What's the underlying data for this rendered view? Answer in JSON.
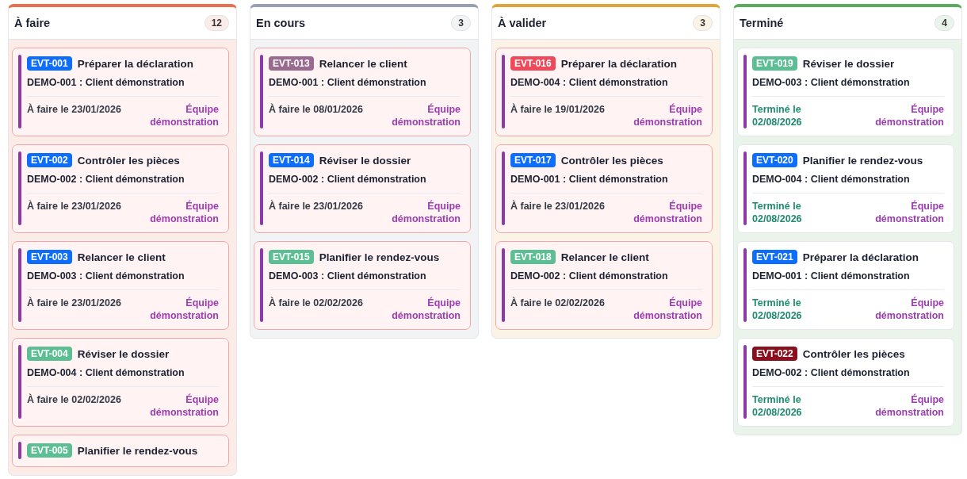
{
  "columns": [
    {
      "title": "À faire",
      "count": "12",
      "color": "#e8704f",
      "cards": [
        {
          "kind": "overdue",
          "code": "EVT-001",
          "color": "#0d6efd",
          "title": "Préparer la déclaration",
          "client": "DEMO-001 : Client démonstration",
          "date": "À faire le 23/01/2026",
          "team": "Équipe démonstration"
        },
        {
          "kind": "overdue",
          "code": "EVT-002",
          "color": "#0d6efd",
          "title": "Contrôler les pièces",
          "client": "DEMO-002 : Client démonstration",
          "date": "À faire le 23/01/2026",
          "team": "Équipe démonstration"
        },
        {
          "kind": "overdue",
          "code": "EVT-003",
          "color": "#0d6efd",
          "title": "Relancer le client",
          "client": "DEMO-003 : Client démonstration",
          "date": "À faire le 23/01/2026",
          "team": "Équipe démonstration"
        },
        {
          "kind": "overdue",
          "code": "EVT-004",
          "color": "#5cbf94",
          "title": "Réviser le dossier",
          "client": "DEMO-004 : Client démonstration",
          "date": "À faire le 02/02/2026",
          "team": "Équipe démonstration"
        },
        {
          "kind": "overdue",
          "code": "EVT-005",
          "color": "#5cbf94",
          "title": "Planifier le rendez-vous"
        }
      ]
    },
    {
      "title": "En cours",
      "count": "3",
      "color": "#97a1b3",
      "cards": [
        {
          "kind": "overdue",
          "code": "EVT-013",
          "color": "#9a6b8f",
          "title": "Relancer le client",
          "client": "DEMO-001 : Client démonstration",
          "date": "À faire le 08/01/2026",
          "team": "Équipe démonstration"
        },
        {
          "kind": "overdue",
          "code": "EVT-014",
          "color": "#0d6efd",
          "title": "Réviser le dossier",
          "client": "DEMO-002 : Client démonstration",
          "date": "À faire le 23/01/2026",
          "team": "Équipe démonstration"
        },
        {
          "kind": "overdue",
          "code": "EVT-015",
          "color": "#5cbf94",
          "title": "Planifier le rendez-vous",
          "client": "DEMO-003 : Client démonstration",
          "date": "À faire le 02/02/2026",
          "team": "Équipe démonstration"
        }
      ]
    },
    {
      "title": "À valider",
      "count": "3",
      "color": "#e3a33a",
      "cards": [
        {
          "kind": "overdue",
          "code": "EVT-016",
          "color": "#f04a5a",
          "title": "Préparer la déclaration",
          "client": "DEMO-004 : Client démonstration",
          "date": "À faire le 19/01/2026",
          "team": "Équipe démonstration"
        },
        {
          "kind": "overdue",
          "code": "EVT-017",
          "color": "#0d6efd",
          "title": "Contrôler les pièces",
          "client": "DEMO-001 : Client démonstration",
          "date": "À faire le 23/01/2026",
          "team": "Équipe démonstration"
        },
        {
          "kind": "overdue",
          "code": "EVT-018",
          "color": "#5cbf94",
          "title": "Relancer le client",
          "client": "DEMO-002 : Client démonstration",
          "date": "À faire le 02/02/2026",
          "team": "Équipe démonstration"
        }
      ]
    },
    {
      "title": "Terminé",
      "count": "4",
      "color": "#5aab5e",
      "cards": [
        {
          "kind": "done",
          "code": "EVT-019",
          "color": "#5cbf94",
          "title": "Réviser le dossier",
          "client": "DEMO-003 : Client démonstration",
          "date": "Terminé le 02/08/2026",
          "team": "Équipe démonstration"
        },
        {
          "kind": "done",
          "code": "EVT-020",
          "color": "#0d6efd",
          "title": "Planifier le rendez-vous",
          "client": "DEMO-004 : Client démonstration",
          "date": "Terminé le 02/08/2026",
          "team": "Équipe démonstration"
        },
        {
          "kind": "done",
          "code": "EVT-021",
          "color": "#0d6efd",
          "title": "Préparer la déclaration",
          "client": "DEMO-001 : Client démonstration",
          "date": "Terminé le 02/08/2026",
          "team": "Équipe démonstration"
        },
        {
          "kind": "done",
          "code": "EVT-022",
          "color": "#8b0f1c",
          "title": "Contrôler les pièces",
          "client": "DEMO-002 : Client démonstration",
          "date": "Terminé le 02/08/2026",
          "team": "Équipe démonstration"
        }
      ]
    }
  ]
}
